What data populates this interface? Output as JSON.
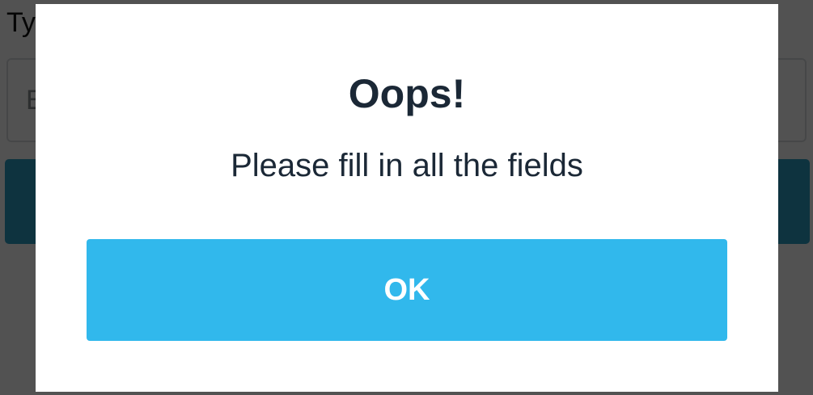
{
  "background_page": {
    "label": "Ty",
    "input_value": "E"
  },
  "dialog": {
    "title": "Oops!",
    "message": "Please fill in all the fields",
    "ok_label": "OK"
  },
  "colors": {
    "overlay": "#4f4f4f",
    "dialog_background": "#ffffff",
    "text": "#1b2836",
    "ok_button": "#31b8ec",
    "background_button": "#2e9ec3"
  }
}
